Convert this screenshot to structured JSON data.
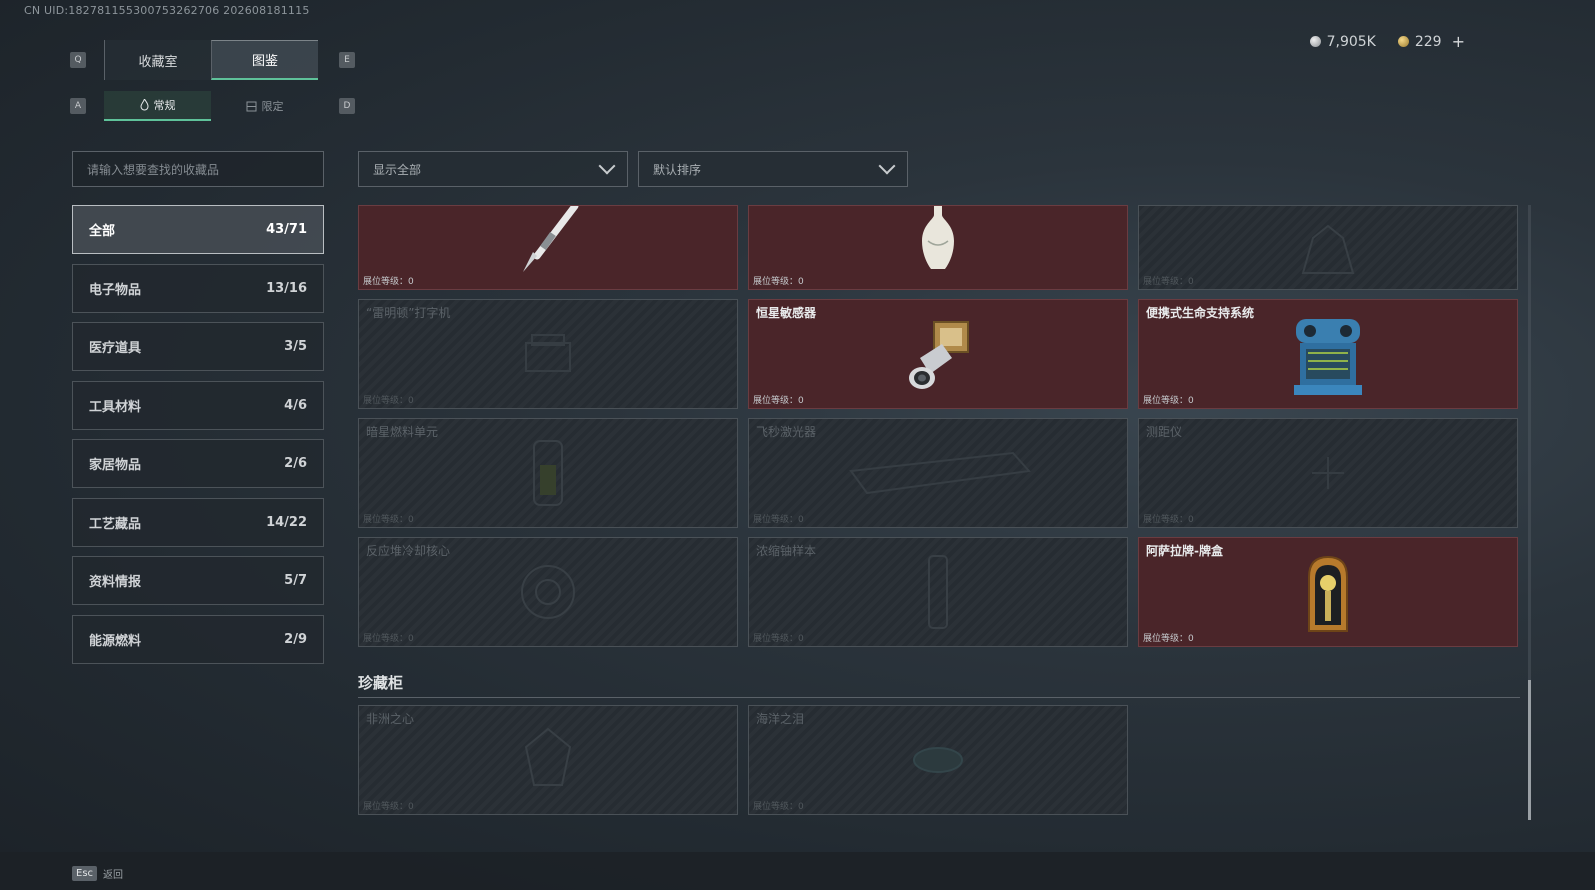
{
  "uid": "CN UID:182781155300753262706 202608181115",
  "currency": {
    "silver": "7,905K",
    "gold": "229",
    "add": "+"
  },
  "keys": {
    "q": "Q",
    "e": "E",
    "a": "A",
    "d": "D"
  },
  "tabs": [
    {
      "label": "收藏室",
      "active": false
    },
    {
      "label": "图鉴",
      "active": true
    }
  ],
  "subtabs": [
    {
      "label": "常规",
      "icon": "flame-icon",
      "active": true
    },
    {
      "label": "限定",
      "icon": "box-icon",
      "active": false
    }
  ],
  "search": {
    "placeholder": "请输入想要查找的收藏品"
  },
  "filters": {
    "show": "显示全部",
    "sort": "默认排序"
  },
  "categories": [
    {
      "label": "全部",
      "count": "43/71",
      "active": true
    },
    {
      "label": "电子物品",
      "count": "13/16"
    },
    {
      "label": "医疗道具",
      "count": "3/5"
    },
    {
      "label": "工具材料",
      "count": "4/6"
    },
    {
      "label": "家居物品",
      "count": "2/6"
    },
    {
      "label": "工艺藏品",
      "count": "14/22"
    },
    {
      "label": "资料情报",
      "count": "5/7"
    },
    {
      "label": "能源燃料",
      "count": "2/9"
    }
  ],
  "level_label": "展位等级：0",
  "items": [
    {
      "name": "",
      "owned": true,
      "icon": "fountain-pen-icon"
    },
    {
      "name": "",
      "owned": true,
      "icon": "porcelain-vase-icon"
    },
    {
      "name": "",
      "owned": false,
      "icon": "statue-icon"
    },
    {
      "name": "“雷明顿”打字机",
      "owned": false,
      "icon": "typewriter-icon"
    },
    {
      "name": "恒星敏感器",
      "owned": true,
      "icon": "star-sensor-icon"
    },
    {
      "name": "便携式生命支持系统",
      "owned": true,
      "icon": "life-support-icon"
    },
    {
      "name": "暗星燃料单元",
      "owned": false,
      "icon": "fuel-cell-icon"
    },
    {
      "name": "飞秒激光器",
      "owned": false,
      "icon": "laser-icon"
    },
    {
      "name": "测距仪",
      "owned": false,
      "icon": "rangefinder-icon"
    },
    {
      "name": "反应堆冷却核心",
      "owned": false,
      "icon": "reactor-core-icon"
    },
    {
      "name": "浓缩铀样本",
      "owned": false,
      "icon": "uranium-sample-icon"
    },
    {
      "name": "阿萨拉牌-牌盒",
      "owned": true,
      "icon": "card-box-icon"
    }
  ],
  "section": {
    "title": "珍藏柜"
  },
  "treasures": [
    {
      "name": "非洲之心",
      "owned": false,
      "icon": "diamond-icon"
    },
    {
      "name": "海洋之泪",
      "owned": false,
      "icon": "gem-icon"
    }
  ],
  "footer": {
    "key": "Esc",
    "label": "返回"
  }
}
